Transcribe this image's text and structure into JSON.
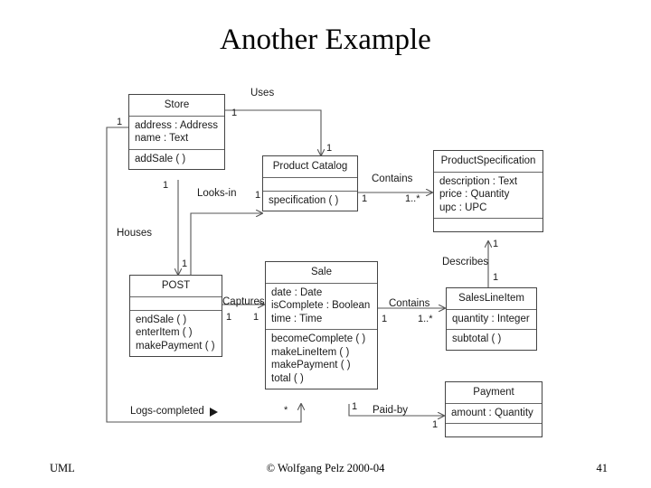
{
  "slide": {
    "title": "Another Example",
    "footer_left": "UML",
    "footer_center": "© Wolfgang Pelz 2000-04",
    "footer_right": "41"
  },
  "colors": {
    "background": "#ffffff",
    "text": "#000000",
    "box_border": "#444444",
    "compartment_rule": "#666666",
    "connector": "#555555"
  },
  "classes": {
    "store": {
      "name": "Store",
      "attributes": [
        "address : Address",
        "name : Text"
      ],
      "operations": [
        "addSale ( )"
      ]
    },
    "product_catalog": {
      "name": "Product Catalog",
      "attributes": [],
      "operations": [
        "specification ( )"
      ]
    },
    "product_specification": {
      "name": "ProductSpecification",
      "attributes": [
        "description : Text",
        "price : Quantity",
        "upc : UPC"
      ],
      "operations": []
    },
    "post": {
      "name": "POST",
      "attributes": [],
      "operations": [
        "endSale ( )",
        "enterItem ( )",
        "makePayment ( )"
      ]
    },
    "sale": {
      "name": "Sale",
      "attributes": [
        "date : Date",
        "isComplete : Boolean",
        "time : Time"
      ],
      "operations": [
        "becomeComplete ( )",
        "makeLineItem ( )",
        "makePayment ( )",
        "total ( )"
      ]
    },
    "sales_line_item": {
      "name": "SalesLineItem",
      "attributes": [
        "quantity : Integer"
      ],
      "operations": [
        "subtotal ( )"
      ]
    },
    "payment": {
      "name": "Payment",
      "attributes": [
        "amount : Quantity"
      ],
      "operations": []
    }
  },
  "associations": {
    "uses": {
      "label": "Uses",
      "source_mult": "1",
      "target_mult": "1"
    },
    "contains_catalog_spec": {
      "label": "Contains",
      "source_mult": "1",
      "target_mult": "1..*"
    },
    "looks_in": {
      "label": "Looks-in",
      "source_mult": "1",
      "target_mult": "1"
    },
    "houses": {
      "label": "Houses",
      "source_mult": "1",
      "target_mult": "1"
    },
    "captures": {
      "label": "Captures",
      "source_mult": "1",
      "target_mult": "1"
    },
    "contains_sale_line": {
      "label": "Contains",
      "source_mult": "1",
      "target_mult": "1..*"
    },
    "describes": {
      "label": "Describes",
      "source_mult": "1",
      "target_mult": "1"
    },
    "logs_completed": {
      "label": "Logs-completed",
      "direction_marker": "▶",
      "source_mult": "1",
      "target_mult": "*"
    },
    "paid_by": {
      "label": "Paid-by",
      "source_mult": "1",
      "target_mult": "1"
    }
  }
}
